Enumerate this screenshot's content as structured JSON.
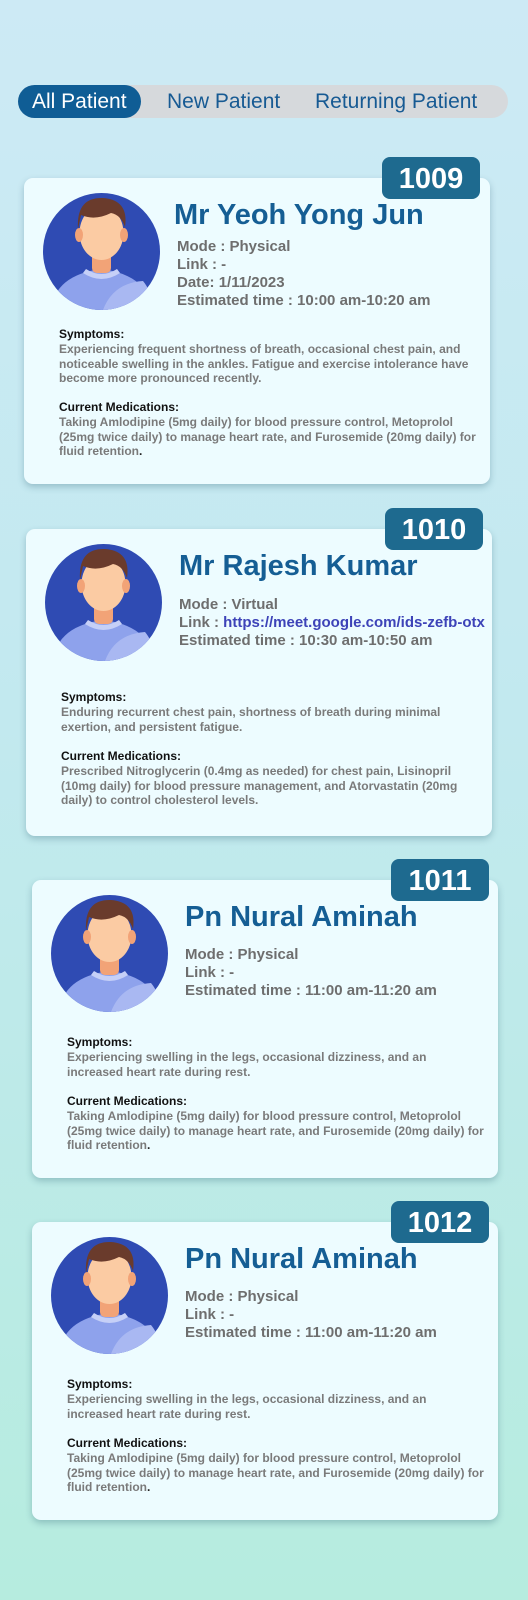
{
  "tabs": [
    {
      "label": "All Patient",
      "active": true
    },
    {
      "label": "New Patient",
      "active": false
    },
    {
      "label": "Returning Patient",
      "active": false
    }
  ],
  "labels": {
    "mode": "Mode : ",
    "link": "Link : ",
    "date": "Date: ",
    "estimated_time": "Estimated time  : ",
    "symptoms": "Symptoms:",
    "medications": "Current Medications:"
  },
  "colors": {
    "accent": "#0f5d95",
    "badge": "#1e6a8f",
    "name": "#155e94",
    "card": "#edfcff",
    "link": "#3d43b8"
  },
  "patients": [
    {
      "id": "1009",
      "name": "Mr Yeoh Yong Jun",
      "mode": "Physical",
      "link": "-",
      "date": "1/11/2023",
      "time": "10:00 am-10:20 am",
      "symptoms": "Experiencing frequent shortness of breath, occasional chest pain, and noticeable swelling in the ankles. Fatigue and exercise intolerance have become more pronounced recently.",
      "medications": "Taking Amlodipine (5mg daily) for blood pressure control, Metoprolol (25mg twice daily) to manage heart rate, and Furosemide (20mg daily) for fluid retention",
      "avatar_icon": "male-patient-avatar-icon"
    },
    {
      "id": "1010",
      "name": "Mr Rajesh Kumar",
      "mode": "Virtual",
      "link": "https://meet.google.com/ids-zefb-otx",
      "time": "10:30 am-10:50 am",
      "symptoms": "Enduring recurrent chest pain, shortness of breath during minimal exertion, and persistent fatigue.",
      "medications": "Prescribed Nitroglycerin (0.4mg as needed) for chest pain, Lisinopril (10mg daily) for blood pressure management, and Atorvastatin (20mg daily) to control cholesterol levels.",
      "avatar_icon": "male-patient-avatar-icon"
    },
    {
      "id": "1011",
      "name": "Pn Nural Aminah",
      "mode": "Physical",
      "link": "-",
      "time": "11:00 am-11:20 am",
      "symptoms": "Experiencing swelling in the legs, occasional dizziness, and an increased heart rate during rest.",
      "medications": "Taking Amlodipine (5mg daily) for blood pressure control, Metoprolol (25mg twice daily) to manage heart rate, and Furosemide (20mg daily) for fluid retention",
      "avatar_icon": "male-patient-avatar-icon"
    },
    {
      "id": "1012",
      "name": "Pn Nural Aminah",
      "mode": "Physical",
      "link": "-",
      "time": "11:00 am-11:20 am",
      "symptoms": "Experiencing swelling in the legs, occasional dizziness, and an increased heart rate during rest.",
      "medications": "Taking Amlodipine (5mg daily) for blood pressure control, Metoprolol (25mg twice daily) to manage heart rate, and Furosemide (20mg daily) for fluid retention",
      "avatar_icon": "male-patient-avatar-icon"
    }
  ]
}
